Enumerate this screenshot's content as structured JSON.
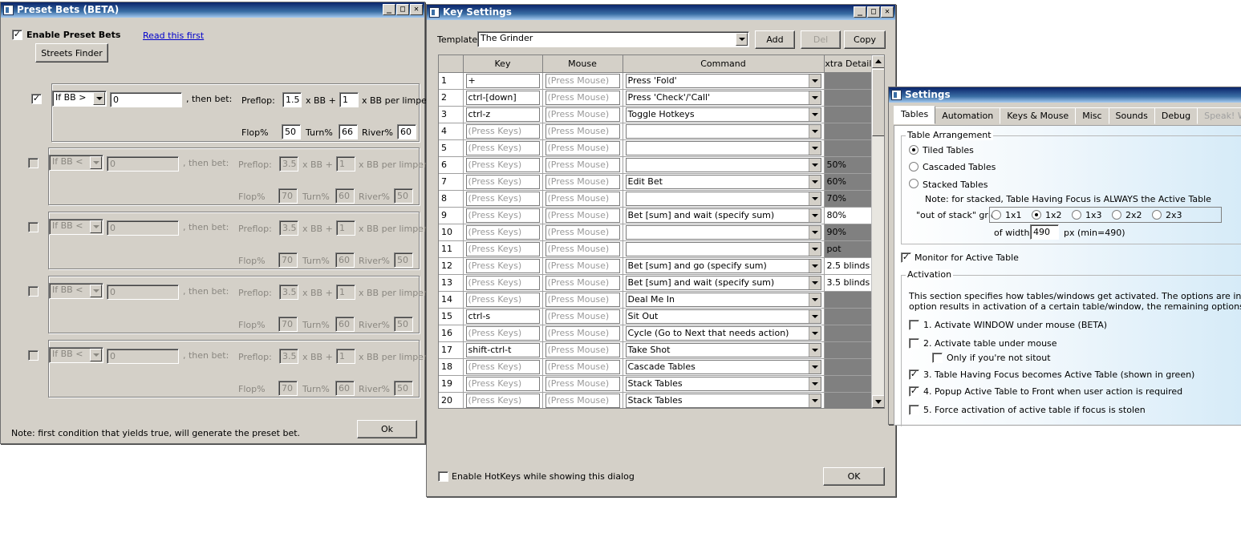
{
  "preset_bets": {
    "title": "Preset Bets (BETA)",
    "enable_label": "Enable Preset Bets",
    "read_link": "Read this first",
    "streets_button": "Streets Finder",
    "then_bet": ", then bet:",
    "preflop": "Preflop:",
    "xbb_plus": "x BB +",
    "per_limper": "x BB per limper",
    "flop": "Flop%",
    "turn": "Turn%",
    "river": "River%",
    "rules": [
      {
        "checked": true,
        "enabled": true,
        "cond": "If BB >",
        "value": "0",
        "preflop": "1.5",
        "limper": "1",
        "flop": "50",
        "turn": "66",
        "river": "60"
      },
      {
        "checked": false,
        "enabled": false,
        "cond": "If BB <",
        "value": "0",
        "preflop": "3.5",
        "limper": "1",
        "flop": "70",
        "turn": "60",
        "river": "50"
      },
      {
        "checked": false,
        "enabled": false,
        "cond": "If BB <",
        "value": "0",
        "preflop": "3.5",
        "limper": "1",
        "flop": "70",
        "turn": "60",
        "river": "50"
      },
      {
        "checked": false,
        "enabled": false,
        "cond": "If BB <",
        "value": "0",
        "preflop": "3.5",
        "limper": "1",
        "flop": "70",
        "turn": "60",
        "river": "50"
      },
      {
        "checked": false,
        "enabled": false,
        "cond": "If BB <",
        "value": "0",
        "preflop": "3.5",
        "limper": "1",
        "flop": "70",
        "turn": "60",
        "river": "50"
      }
    ],
    "note": "Note: first condition that yields true, will generate the preset bet.",
    "ok": "Ok"
  },
  "key_settings": {
    "title": "Key Settings",
    "template_label": "Template",
    "template_value": "The Grinder",
    "add": "Add",
    "del": "Del",
    "copy": "Copy",
    "columns": {
      "key": "Key",
      "mouse": "Mouse",
      "command": "Command",
      "xtra": "xtra Detail"
    },
    "rows": [
      {
        "n": "1",
        "key": "+",
        "mouse": "(Press Mouse)",
        "cmd": "Press 'Fold'",
        "xtra": ""
      },
      {
        "n": "2",
        "key": "ctrl-[down]",
        "mouse": "(Press Mouse)",
        "cmd": "Press 'Check'/'Call'",
        "xtra": ""
      },
      {
        "n": "3",
        "key": "ctrl-z",
        "mouse": "(Press Mouse)",
        "cmd": "Toggle Hotkeys",
        "xtra": ""
      },
      {
        "n": "4",
        "key": "(Press Keys)",
        "mouse": "(Press Mouse)",
        "cmd": "",
        "xtra": ""
      },
      {
        "n": "5",
        "key": "(Press Keys)",
        "mouse": "(Press Mouse)",
        "cmd": "",
        "xtra": ""
      },
      {
        "n": "6",
        "key": "(Press Keys)",
        "mouse": "(Press Mouse)",
        "cmd": "",
        "xtra": "50%"
      },
      {
        "n": "7",
        "key": "(Press Keys)",
        "mouse": "(Press Mouse)",
        "cmd": "Edit Bet",
        "xtra": "60%"
      },
      {
        "n": "8",
        "key": "(Press Keys)",
        "mouse": "(Press Mouse)",
        "cmd": "",
        "xtra": "70%"
      },
      {
        "n": "9",
        "key": "(Press Keys)",
        "mouse": "(Press Mouse)",
        "cmd": "Bet [sum] and wait (specify sum)",
        "xtra": "80%"
      },
      {
        "n": "10",
        "key": "(Press Keys)",
        "mouse": "(Press Mouse)",
        "cmd": "",
        "xtra": "90%"
      },
      {
        "n": "11",
        "key": "(Press Keys)",
        "mouse": "(Press Mouse)",
        "cmd": "",
        "xtra": "pot"
      },
      {
        "n": "12",
        "key": "(Press Keys)",
        "mouse": "(Press Mouse)",
        "cmd": "Bet [sum] and go (specify sum)",
        "xtra": "2.5 blinds"
      },
      {
        "n": "13",
        "key": "(Press Keys)",
        "mouse": "(Press Mouse)",
        "cmd": "Bet [sum] and wait (specify sum)",
        "xtra": "3.5 blinds"
      },
      {
        "n": "14",
        "key": "(Press Keys)",
        "mouse": "(Press Mouse)",
        "cmd": "Deal Me In",
        "xtra": ""
      },
      {
        "n": "15",
        "key": "ctrl-s",
        "mouse": "(Press Mouse)",
        "cmd": "Sit Out",
        "xtra": ""
      },
      {
        "n": "16",
        "key": "(Press Keys)",
        "mouse": "(Press Mouse)",
        "cmd": "Cycle (Go to Next that needs action)",
        "xtra": ""
      },
      {
        "n": "17",
        "key": "shift-ctrl-t",
        "mouse": "(Press Mouse)",
        "cmd": "Take Shot",
        "xtra": ""
      },
      {
        "n": "18",
        "key": "(Press Keys)",
        "mouse": "(Press Mouse)",
        "cmd": "Cascade Tables",
        "xtra": ""
      },
      {
        "n": "19",
        "key": "(Press Keys)",
        "mouse": "(Press Mouse)",
        "cmd": "Stack Tables",
        "xtra": ""
      },
      {
        "n": "20",
        "key": "(Press Keys)",
        "mouse": "(Press Mouse)",
        "cmd": "Stack Tables",
        "xtra": ""
      }
    ],
    "enable_hotkeys": "Enable HotKeys while showing this dialog",
    "ok": "OK"
  },
  "settings": {
    "title": "Settings",
    "tabs": [
      "Tables",
      "Automation",
      "Keys & Mouse",
      "Misc",
      "Sounds",
      "Debug",
      "Speak! W"
    ],
    "arrangement_legend": "Table Arrangement",
    "tiled": "Tiled Tables",
    "cascaded": "Cascaded Tables",
    "stacked": "Stacked Tables",
    "stack_note": "Note: for stacked, Table Having Focus is ALWAYS the Active Table",
    "grid_label": "\"out of stack\" grid",
    "grid_options": [
      "1x1",
      "1x2",
      "1x3",
      "2x2",
      "2x3"
    ],
    "grid_selected": "1x2",
    "width_label": "of width",
    "width_value": "490",
    "width_unit": "px (min=490)",
    "monitor": "Monitor for Active Table",
    "activation_legend": "Activation",
    "activation_text1": "This section specifies how tables/windows get activated. The options are in order of pri",
    "activation_text2": "option results in activation of a certain table/window, the remaining options will be igno",
    "opt1": "1. Activate WINDOW under mouse (BETA)",
    "opt2": "2. Activate table under mouse",
    "opt2a": "Only if you're not sitout",
    "opt3": "3. Table Having Focus becomes Active Table (shown in green)",
    "opt4": "4. Popup Active Table to Front when user action is required",
    "opt5": "5. Force activation of active table if focus is stolen"
  },
  "icons": {
    "minimize": "_",
    "maximize": "□",
    "close": "✕",
    "check": "✓"
  }
}
